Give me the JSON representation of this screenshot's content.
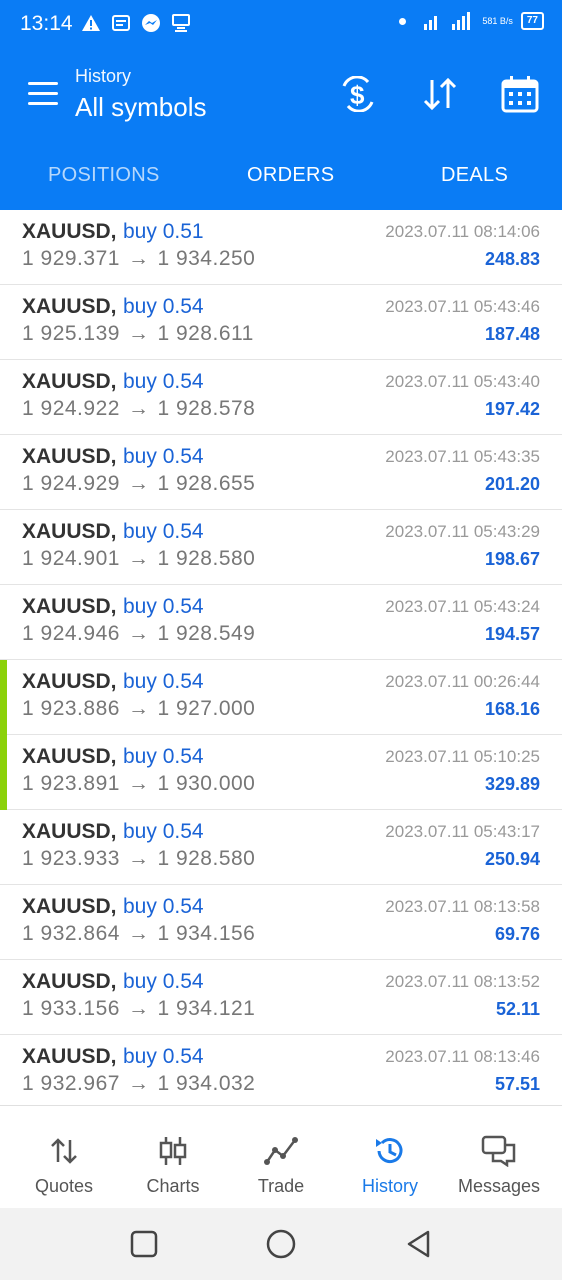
{
  "status_bar": {
    "time": "13:14",
    "network_speed": "581 B/s",
    "network_type": "4G",
    "battery": "77"
  },
  "header": {
    "title": "History",
    "subtitle": "All symbols"
  },
  "tabs": [
    {
      "label": "POSITIONS",
      "active": false
    },
    {
      "label": "ORDERS",
      "active": true
    },
    {
      "label": "DEALS",
      "active": true
    }
  ],
  "deals": [
    {
      "symbol": "XAUUSD,",
      "side": "buy 0.51",
      "open_price": "1 929.371",
      "close_price": "1 934.250",
      "time": "2023.07.11 08:14:06",
      "profit": "248.83",
      "highlighted": false
    },
    {
      "symbol": "XAUUSD,",
      "side": "buy 0.54",
      "open_price": "1 925.139",
      "close_price": "1 928.611",
      "time": "2023.07.11 05:43:46",
      "profit": "187.48",
      "highlighted": false
    },
    {
      "symbol": "XAUUSD,",
      "side": "buy 0.54",
      "open_price": "1 924.922",
      "close_price": "1 928.578",
      "time": "2023.07.11 05:43:40",
      "profit": "197.42",
      "highlighted": false
    },
    {
      "symbol": "XAUUSD,",
      "side": "buy 0.54",
      "open_price": "1 924.929",
      "close_price": "1 928.655",
      "time": "2023.07.11 05:43:35",
      "profit": "201.20",
      "highlighted": false
    },
    {
      "symbol": "XAUUSD,",
      "side": "buy 0.54",
      "open_price": "1 924.901",
      "close_price": "1 928.580",
      "time": "2023.07.11 05:43:29",
      "profit": "198.67",
      "highlighted": false
    },
    {
      "symbol": "XAUUSD,",
      "side": "buy 0.54",
      "open_price": "1 924.946",
      "close_price": "1 928.549",
      "time": "2023.07.11 05:43:24",
      "profit": "194.57",
      "highlighted": false
    },
    {
      "symbol": "XAUUSD,",
      "side": "buy 0.54",
      "open_price": "1 923.886",
      "close_price": "1 927.000",
      "time": "2023.07.11 00:26:44",
      "profit": "168.16",
      "highlighted": true
    },
    {
      "symbol": "XAUUSD,",
      "side": "buy 0.54",
      "open_price": "1 923.891",
      "close_price": "1 930.000",
      "time": "2023.07.11 05:10:25",
      "profit": "329.89",
      "highlighted": true
    },
    {
      "symbol": "XAUUSD,",
      "side": "buy 0.54",
      "open_price": "1 923.933",
      "close_price": "1 928.580",
      "time": "2023.07.11 05:43:17",
      "profit": "250.94",
      "highlighted": false
    },
    {
      "symbol": "XAUUSD,",
      "side": "buy 0.54",
      "open_price": "1 932.864",
      "close_price": "1 934.156",
      "time": "2023.07.11 08:13:58",
      "profit": "69.76",
      "highlighted": false
    },
    {
      "symbol": "XAUUSD,",
      "side": "buy 0.54",
      "open_price": "1 933.156",
      "close_price": "1 934.121",
      "time": "2023.07.11 08:13:52",
      "profit": "52.11",
      "highlighted": false
    },
    {
      "symbol": "XAUUSD,",
      "side": "buy 0.54",
      "open_price": "1 932.967",
      "close_price": "1 934.032",
      "time": "2023.07.11 08:13:46",
      "profit": "57.51",
      "highlighted": false
    }
  ],
  "price_separator": "→",
  "bottom_nav": [
    {
      "label": "Quotes",
      "icon": "quotes-icon",
      "active": false
    },
    {
      "label": "Charts",
      "icon": "charts-icon",
      "active": false
    },
    {
      "label": "Trade",
      "icon": "trade-icon",
      "active": false
    },
    {
      "label": "History",
      "icon": "history-icon",
      "active": true
    },
    {
      "label": "Messages",
      "icon": "messages-icon",
      "active": false
    }
  ],
  "colors": {
    "primary": "#0a7cf5",
    "buy": "#1a63d6",
    "highlight_marker": "#8bd10a",
    "active_nav": "#1a7ae8"
  }
}
